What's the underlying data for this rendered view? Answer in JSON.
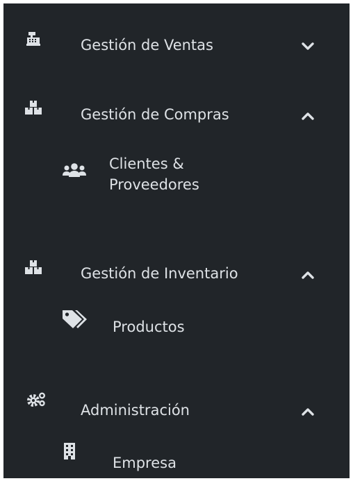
{
  "sidebar": {
    "sections": [
      {
        "label": "Gestión de Ventas",
        "icon": "cash-register-icon",
        "expanded": false,
        "items": []
      },
      {
        "label": "Gestión de Compras",
        "icon": "boxes-icon",
        "expanded": true,
        "items": [
          {
            "label": "Clientes & Proveedores",
            "icon": "users-icon"
          }
        ]
      },
      {
        "label": "Gestión de Inventario",
        "icon": "boxes-icon",
        "expanded": true,
        "items": [
          {
            "label": "Productos",
            "icon": "tags-icon"
          }
        ]
      },
      {
        "label": "Administración",
        "icon": "cogs-icon",
        "expanded": true,
        "items": [
          {
            "label": "Empresa",
            "icon": "building-icon"
          }
        ]
      }
    ]
  },
  "colors": {
    "background": "#212529",
    "text": "#dee2e6"
  }
}
